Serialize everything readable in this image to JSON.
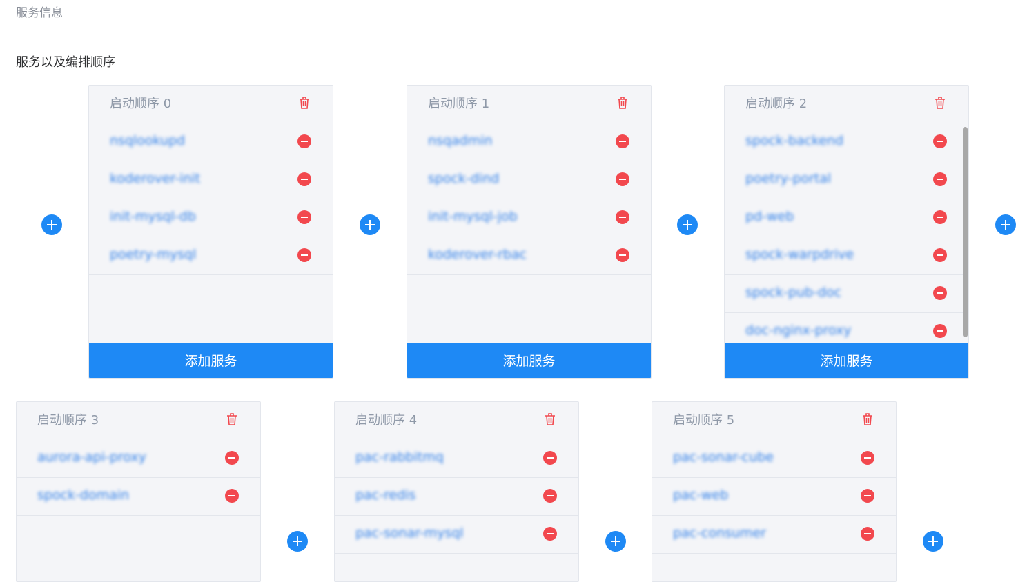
{
  "section_title": "服务信息",
  "subtitle": "服务以及编排顺序",
  "add_service_label": "添加服务",
  "colors": {
    "primary": "#1e89f5",
    "danger": "#f2484e",
    "service_text": "#2f7fe8"
  },
  "groups": [
    {
      "title": "启动顺序 0",
      "services": [
        "nsqlookupd",
        "koderover-init",
        "init-mysql-db",
        "poetry-mysql"
      ]
    },
    {
      "title": "启动顺序 1",
      "services": [
        "nsqadmin",
        "spock-dind",
        "init-mysql-job",
        "koderover-rbac"
      ]
    },
    {
      "title": "启动顺序 2",
      "services": [
        "spock-backend",
        "poetry-portal",
        "pd-web",
        "spock-warpdrive",
        "spock-pub-doc",
        "doc-nginx-proxy"
      ]
    },
    {
      "title": "启动顺序 3",
      "services": [
        "aurora-api-proxy",
        "spock-domain"
      ]
    },
    {
      "title": "启动顺序 4",
      "services": [
        "pac-rabbitmq",
        "pac-redis",
        "pac-sonar-mysql"
      ]
    },
    {
      "title": "启动顺序 5",
      "services": [
        "pac-sonar-cube",
        "pac-web",
        "pac-consumer"
      ]
    }
  ]
}
